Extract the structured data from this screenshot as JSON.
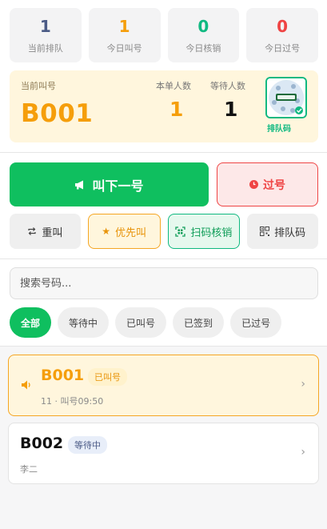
{
  "stats": [
    {
      "value": "1",
      "label": "当前排队",
      "color": "#4b5b86"
    },
    {
      "value": "1",
      "label": "今日叫号",
      "color": "#f59e0b"
    },
    {
      "value": "0",
      "label": "今日核销",
      "color": "#10b981"
    },
    {
      "value": "0",
      "label": "今日过号",
      "color": "#ef4444"
    }
  ],
  "current": {
    "label": "当前叫号",
    "number": "B001",
    "order_people_label": "本单人数",
    "order_people_value": "1",
    "waiting_label": "等待人数",
    "waiting_value": "1",
    "qr_caption": "排队码"
  },
  "actions": {
    "call_next": "叫下一号",
    "pass": "过号",
    "recall": "重叫",
    "priority": "优先叫",
    "scan_verify": "扫码核销",
    "queue_code": "排队码"
  },
  "search": {
    "placeholder": "搜索号码..."
  },
  "filters": [
    "全部",
    "等待中",
    "已叫号",
    "已签到",
    "已过号"
  ],
  "active_filter": "全部",
  "queue": [
    {
      "code": "B001",
      "status": "已叫号",
      "detail": "11 · 叫号09:50"
    },
    {
      "code": "B002",
      "status": "等待中",
      "detail": "李二"
    }
  ],
  "colors": {
    "accent": "#0fbf5f",
    "warning": "#f59e0b",
    "danger": "#ef4444",
    "success": "#10b981"
  }
}
